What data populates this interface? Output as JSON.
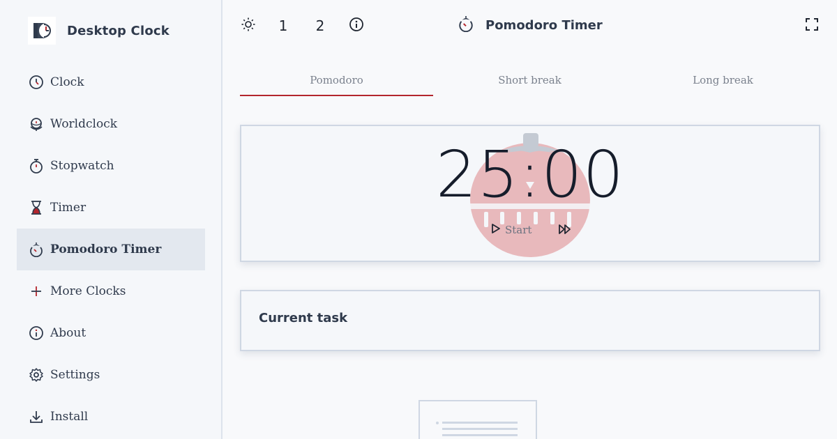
{
  "app": {
    "brand_name": "Desktop Clock"
  },
  "sidebar": {
    "items": [
      {
        "label": "Clock",
        "icon": "clock-icon"
      },
      {
        "label": "Worldclock",
        "icon": "globe-clock-icon"
      },
      {
        "label": "Stopwatch",
        "icon": "stopwatch-icon"
      },
      {
        "label": "Timer",
        "icon": "hourglass-icon"
      },
      {
        "label": "Pomodoro Timer",
        "icon": "pomodoro-icon",
        "active": true
      },
      {
        "label": "More Clocks",
        "icon": "plus-icon"
      },
      {
        "label": "About",
        "icon": "info-icon"
      },
      {
        "label": "Settings",
        "icon": "gear-icon"
      },
      {
        "label": "Install",
        "icon": "download-icon"
      }
    ]
  },
  "topbar": {
    "theme_icon": "sun-icon",
    "layout_1": "1",
    "layout_2": "2",
    "info_icon": "info-icon",
    "title": "Pomodoro Timer",
    "fullscreen_icon": "fullscreen-icon"
  },
  "tabs": [
    {
      "label": "Pomodoro",
      "active": true
    },
    {
      "label": "Short break",
      "active": false
    },
    {
      "label": "Long break",
      "active": false
    }
  ],
  "timer": {
    "time": "25:00",
    "start_label": "Start",
    "skip_icon": "fast-forward-icon"
  },
  "task": {
    "title": "Current task"
  },
  "colors": {
    "accent": "#b3262d",
    "tomato": "#e8b9bc",
    "stem": "#c4cad3"
  }
}
